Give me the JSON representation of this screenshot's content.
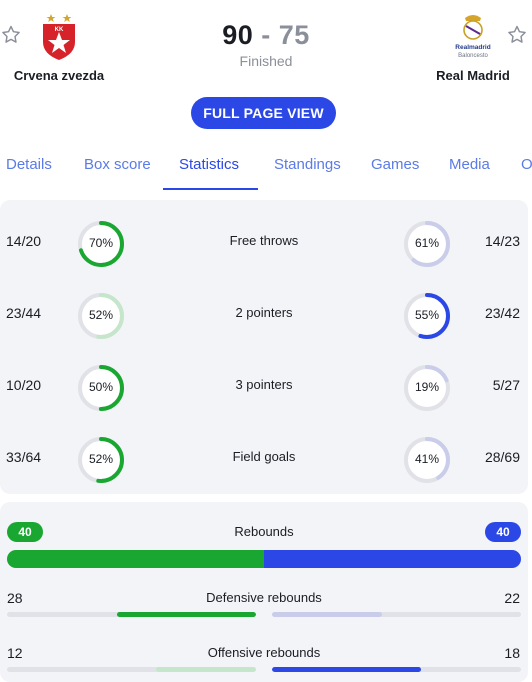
{
  "match": {
    "home_team": "Crvena zvezda",
    "away_team": "Real Madrid",
    "home_score": "90",
    "separator": "-",
    "away_score": "75",
    "status": "Finished",
    "home_logo_text": "KK",
    "away_logo_text": "Realmadrid",
    "away_logo_sub": "Baloncesto"
  },
  "full_page_button": "FULL PAGE VIEW",
  "tabs": [
    {
      "label": "Details"
    },
    {
      "label": "Box score"
    },
    {
      "label": "Statistics"
    },
    {
      "label": "Standings"
    },
    {
      "label": "Games"
    },
    {
      "label": "Media"
    },
    {
      "label": "O"
    }
  ],
  "active_tab": "Statistics",
  "shooting": [
    {
      "label": "Free throws",
      "home": "14/20",
      "home_pct": 70,
      "home_pct_text": "70%",
      "away": "14/23",
      "away_pct": 61,
      "away_pct_text": "61%",
      "leader": "home"
    },
    {
      "label": "2 pointers",
      "home": "23/44",
      "home_pct": 52,
      "home_pct_text": "52%",
      "away": "23/42",
      "away_pct": 55,
      "away_pct_text": "55%",
      "leader": "away"
    },
    {
      "label": "3 pointers",
      "home": "10/20",
      "home_pct": 50,
      "home_pct_text": "50%",
      "away": "5/27",
      "away_pct": 19,
      "away_pct_text": "19%",
      "leader": "home"
    },
    {
      "label": "Field goals",
      "home": "33/64",
      "home_pct": 52,
      "home_pct_text": "52%",
      "away": "28/69",
      "away_pct": 41,
      "away_pct_text": "41%",
      "leader": "home"
    }
  ],
  "rebounds": {
    "label": "Rebounds",
    "home": "40",
    "away": "40",
    "rows": [
      {
        "label": "Defensive rebounds",
        "home": "28",
        "away": "22",
        "home_val": 28,
        "away_val": 22,
        "leader": "home"
      },
      {
        "label": "Offensive rebounds",
        "home": "12",
        "away": "18",
        "home_val": 12,
        "away_val": 18,
        "leader": "away"
      }
    ]
  },
  "colors": {
    "home": "#1aa731",
    "home_light": "#c6e6cc",
    "away": "#2b48e6",
    "away_light": "#c9cdea",
    "track": "#e0e2e8",
    "accent": "#2b48e6"
  }
}
